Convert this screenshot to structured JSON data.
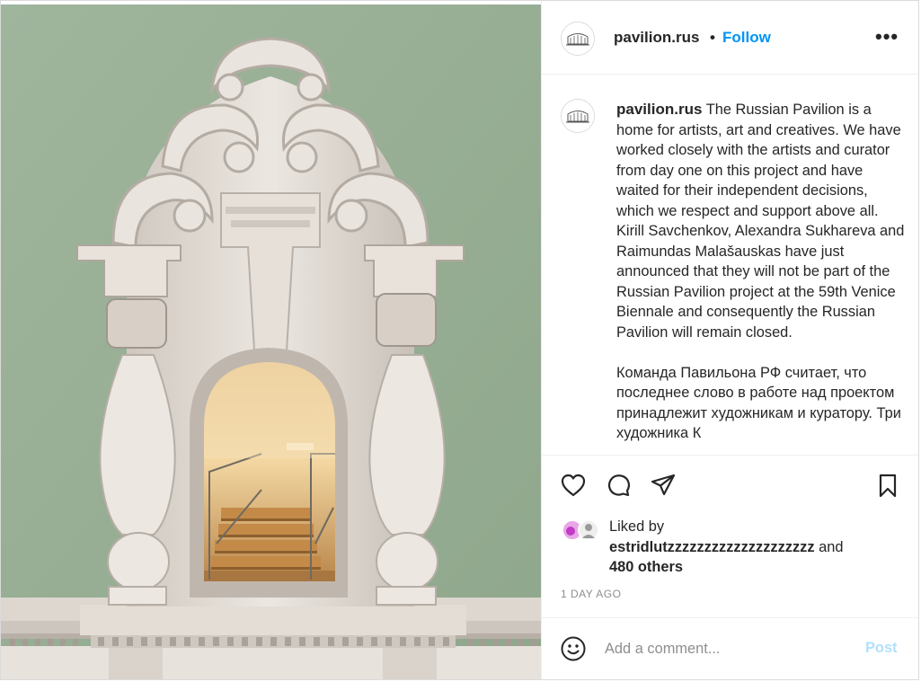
{
  "post": {
    "username": "pavilion.rus",
    "follow_label": "Follow",
    "separator": "•",
    "more_label": "•••",
    "caption_paragraphs": [
      "The Russian Pavilion is a home for artists, art and creatives. We have worked closely with the artists and curator from day one on this project and have waited for their independent decisions, which we respect and support above all.",
      "Kirill Savchenkov, Alexandra Sukhareva and Raimundas Malašauskas have just announced that they will not be part of the Russian Pavilion project at the 59th Venice Biennale and consequently the Russian Pavilion will remain closed.",
      "Команда Павильона РФ считает, что последнее слово в работе над проектом принадлежит художникам и куратору. Три художника К"
    ],
    "liked_prefix": "Liked by",
    "liked_user": "estridlutzzzzzzzzzzzzzzzzzzzz",
    "liked_and": "and",
    "liked_others": "480 others",
    "time_ago": "1 DAY AGO",
    "comment_placeholder": "Add a comment...",
    "post_label": "Post"
  },
  "icons": {
    "like": "heart-icon",
    "comment": "comment-bubble-icon",
    "share": "paper-plane-icon",
    "save": "bookmark-icon",
    "emoji": "smiley-icon",
    "more": "ellipsis-icon"
  },
  "colors": {
    "accent": "#0095f6",
    "post_disabled": "#b2dffc",
    "muted": "#8e8e8e",
    "wall": "#9db29a"
  }
}
